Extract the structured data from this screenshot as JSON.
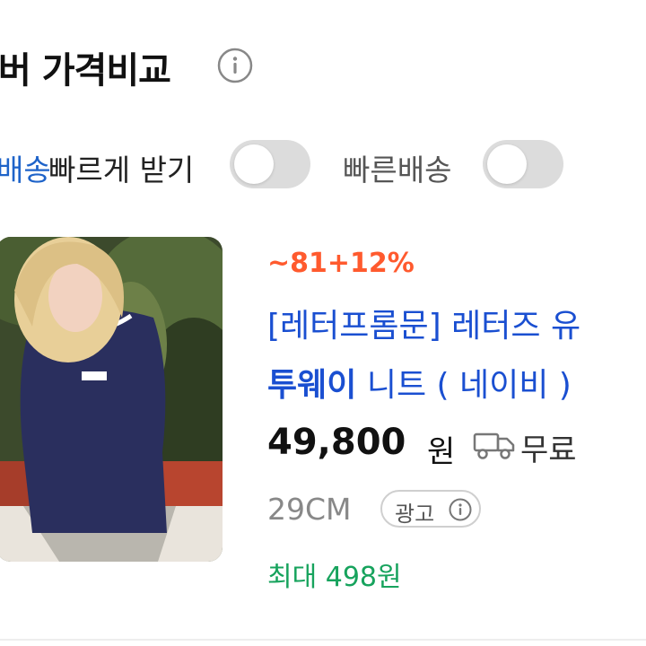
{
  "header": {
    "title": "버 가격비교"
  },
  "filters": {
    "fast_delivery_accent": "배송",
    "fast_delivery_label": "빠르게 받기",
    "fast_shipping_label": "빠른배송"
  },
  "product": {
    "discount": "~81+12%",
    "brand": "[레터프롬문]",
    "title_rest": " 레터즈 유",
    "title_line2_highlight": "투웨이",
    "title_line2_rest": " 니트 ( 네이비 )",
    "price": "49,800",
    "price_unit": "원",
    "shipping": "무료",
    "seller": "29CM",
    "ad_label": "광고",
    "reward": "최대 498원"
  },
  "icons": {
    "info": "info-circle-icon",
    "truck": "truck-icon",
    "ad_info": "info-circle-icon"
  },
  "colors": {
    "accent_blue": "#1a4fd1",
    "discount": "#ff5a2e",
    "reward": "#17a35d",
    "toggle_off": "#dcdcdc"
  }
}
